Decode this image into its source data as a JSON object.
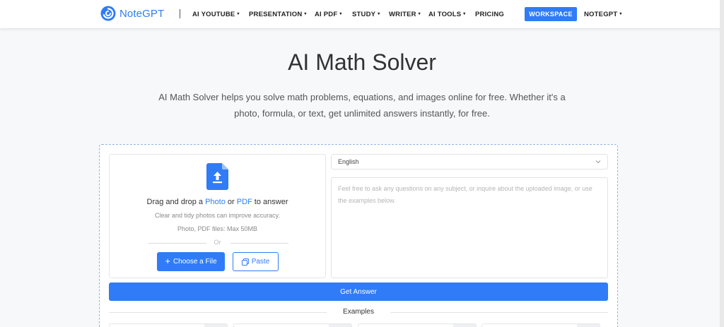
{
  "header": {
    "brand": "NoteGPT",
    "nav": [
      {
        "label": "AI YOUTUBE",
        "dropdown": true
      },
      {
        "label": "PRESENTATION",
        "dropdown": true
      },
      {
        "label": "AI PDF",
        "dropdown": true
      },
      {
        "label": "STUDY",
        "dropdown": true
      },
      {
        "label": "WRITER",
        "dropdown": true
      },
      {
        "label": "AI TOOLS",
        "dropdown": true
      },
      {
        "label": "PRICING",
        "dropdown": false
      }
    ],
    "workspace_label": "WORKSPACE",
    "account_label": "NOTEGPT",
    "caret": "▾"
  },
  "hero": {
    "title": "AI Math Solver",
    "description": "AI Math Solver helps you solve math problems, equations, and images online for free. Whether it's a photo, formula, or text, get unlimited answers instantly, for free."
  },
  "upload": {
    "drag_prefix": "Drag and drop a ",
    "photo_link": "Photo",
    "or_word": " or ",
    "pdf_link": "PDF",
    "drag_suffix": " to answer",
    "hint_accuracy": "Clear and tidy photos can improve accuracy.",
    "hint_size": "Photo, PDF files: Max 50MB",
    "or_divider": "Or",
    "choose_label": "Choose a File",
    "paste_label": "Paste"
  },
  "question": {
    "language": "English",
    "placeholder": "Feel free to ask any questions on any subject, or inquire about the uploaded image, or use the examples below."
  },
  "get_answer_label": "Get Answer",
  "examples_label": "Examples",
  "icons": {
    "logo": "notegpt-swirl-logo",
    "upload": "file-upload-icon",
    "chevron": "chevron-down-icon",
    "paste": "clipboard-icon"
  },
  "colors": {
    "accent": "#2f7cf6",
    "text": "#333333",
    "muted": "#8a8a8a",
    "background": "#f7f8fa"
  }
}
